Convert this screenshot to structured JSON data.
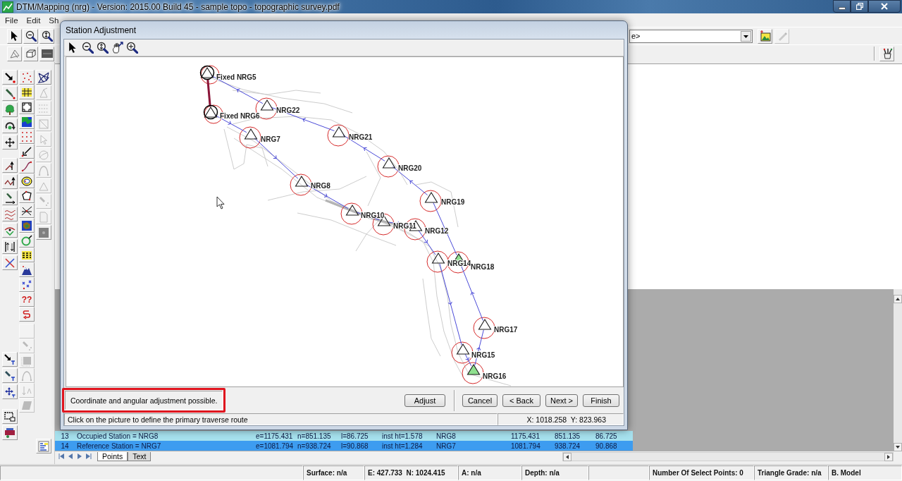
{
  "window": {
    "title": "DTM/Mapping (nrg) - Version: 2015.00 Build 45 - sample topo - topographic survey.pdf"
  },
  "menu": [
    {
      "label": "File"
    },
    {
      "label": "Edit"
    },
    {
      "label": "Sh"
    }
  ],
  "toolbar": {
    "row_1": [
      {
        "kind": "pointer"
      },
      {
        "kind": "zoom-out"
      },
      {
        "kind": "zoom-vertical"
      }
    ],
    "layer_field": {
      "value": "e>"
    },
    "row_1_tools": [
      {
        "kind": "picture",
        "disabled": false
      },
      {
        "kind": "pen",
        "disabled": true
      }
    ],
    "row_2": [
      {
        "kind": "triangle-select"
      },
      {
        "kind": "box-3d"
      },
      {
        "kind": "scale-bar"
      }
    ],
    "row_2_tools": [
      {
        "kind": "brushes"
      }
    ]
  },
  "left_toolbar": [
    {
      "groups": [
        [
          {
            "kind": "pointer-dot",
            "disabled": false
          },
          {
            "kind": "brush",
            "disabled": false
          },
          {
            "kind": "tree",
            "disabled": false
          },
          {
            "kind": "rotate",
            "disabled": false
          },
          {
            "kind": "move",
            "disabled": false
          }
        ],
        [
          {
            "kind": "line-arrow",
            "disabled": false
          },
          {
            "kind": "zigzag",
            "disabled": false
          },
          {
            "kind": "brush-line",
            "disabled": false
          },
          {
            "kind": "waves",
            "disabled": false
          },
          {
            "kind": "curve-dots",
            "disabled": false
          },
          {
            "kind": "split-arrows",
            "disabled": false
          },
          {
            "kind": "cross-arrows",
            "disabled": false
          }
        ],
        [
          {
            "kind": "arrow-t",
            "disabled": false
          },
          {
            "kind": "brush-t",
            "disabled": false
          },
          {
            "kind": "move-t",
            "disabled": false
          }
        ],
        [
          {
            "kind": "frame",
            "disabled": false
          },
          {
            "kind": "plotter",
            "disabled": false
          }
        ]
      ]
    },
    {
      "groups": [
        [
          {
            "kind": "dots",
            "disabled": false
          },
          {
            "kind": "grid",
            "disabled": false
          },
          {
            "kind": "corners",
            "disabled": false
          },
          {
            "kind": "map",
            "disabled": false
          },
          {
            "kind": "dots-row",
            "disabled": false
          },
          {
            "kind": "arrow-sw",
            "disabled": false
          },
          {
            "kind": "curve",
            "disabled": false
          },
          {
            "kind": "contour",
            "disabled": false
          },
          {
            "kind": "polygon",
            "disabled": false
          },
          {
            "kind": "crossing",
            "disabled": false
          },
          {
            "kind": "terrain",
            "disabled": false
          },
          {
            "kind": "ring",
            "disabled": false
          },
          {
            "kind": "table",
            "disabled": false
          },
          {
            "kind": "mountain",
            "disabled": false
          },
          {
            "kind": "scatter-x",
            "disabled": false
          },
          {
            "kind": "text",
            "label": "??",
            "disabled": false
          },
          {
            "kind": "curl",
            "disabled": false
          }
        ],
        [
          {
            "kind": "blank",
            "disabled": true
          },
          {
            "kind": "brush-dots",
            "disabled": true
          },
          {
            "kind": "square-fill",
            "disabled": true
          },
          {
            "kind": "arc",
            "disabled": true
          },
          {
            "kind": "arrow-caret",
            "disabled": true
          },
          {
            "kind": "parallelogram",
            "disabled": true
          }
        ]
      ]
    },
    {
      "groups": [
        [
          {
            "kind": "network",
            "disabled": false
          },
          {
            "kind": "triangle-arrow",
            "disabled": true
          },
          {
            "kind": "dashes",
            "disabled": true
          },
          {
            "kind": "square-diagonal",
            "disabled": true
          },
          {
            "kind": "cursor",
            "disabled": true
          },
          {
            "kind": "circle-curve",
            "disabled": true
          },
          {
            "kind": "arc",
            "disabled": true
          },
          {
            "kind": "tri",
            "disabled": true
          },
          {
            "kind": "brush-dots",
            "disabled": true
          },
          {
            "kind": "page",
            "disabled": true
          },
          {
            "kind": "grey-square",
            "disabled": false
          }
        ],
        [
          {
            "kind": "list",
            "disabled": false
          }
        ]
      ]
    }
  ],
  "dialog": {
    "title": "Station Adjustment",
    "toolbar": [
      {
        "kind": "pointer"
      },
      {
        "kind": "zoom-out"
      },
      {
        "kind": "zoom-vertical"
      },
      {
        "kind": "hand-arrow"
      },
      {
        "kind": "zoom-move"
      }
    ],
    "stations": [
      {
        "label": "Fixed NRG5",
        "kind": "fixed"
      },
      {
        "label": "NRG22",
        "kind": "station"
      },
      {
        "label": "Fixed NRG6",
        "kind": "fixed"
      },
      {
        "label": "NRG7",
        "kind": "station"
      },
      {
        "label": "NRG21",
        "kind": "station"
      },
      {
        "label": "NRG20",
        "kind": "station"
      },
      {
        "label": "NRG8",
        "kind": "station"
      },
      {
        "label": "NRG19",
        "kind": "station"
      },
      {
        "label": "NRG10",
        "kind": "station"
      },
      {
        "label": "NRG11",
        "kind": "station"
      },
      {
        "label": "NRG12",
        "kind": "station"
      },
      {
        "label": "NRG14",
        "kind": "station"
      },
      {
        "label": "NRG18",
        "kind": "marked"
      },
      {
        "label": "NRG17",
        "kind": "station"
      },
      {
        "label": "NRG15",
        "kind": "station"
      },
      {
        "label": "NRG16",
        "kind": "marked"
      }
    ],
    "message": "Coordinate and angular adjustment possible.",
    "message_highlighted": true,
    "adjust_button": {
      "label": "Adjust"
    },
    "wizard_buttons": [
      {
        "label": "Cancel"
      },
      {
        "label": "< Back"
      },
      {
        "label": "Next >"
      },
      {
        "label": "Finish"
      }
    ],
    "hint": "Click on the picture to define the primary traverse route",
    "coordinates": "X: 1018.258  Y: 823.963"
  },
  "table": {
    "rows": [
      {
        "number": "13",
        "cells": [
          "Occupied Station = NRG8",
          "e=1175.431",
          "n=851.135",
          "l=86.725",
          "inst ht=1.578",
          "NRG8",
          "1175.431",
          "851.135",
          "86.725"
        ],
        "selected": false
      },
      {
        "number": "14",
        "cells": [
          "Reference Station = NRG7",
          "e=1081.794",
          "n=938.724",
          "l=90.868",
          "inst ht=1.284",
          "NRG7",
          "1081.794",
          "938.724",
          "90.868"
        ],
        "selected": true
      }
    ]
  },
  "sheet_tabs": [
    {
      "label": "Points",
      "selected": true
    },
    {
      "label": "Text",
      "selected": false
    }
  ],
  "status_bar": [
    "Surface: n/a",
    "E: 427.733  N: 1024.415",
    "A: n/a",
    "Depth: n/a",
    "Number Of Select Points: 0",
    "Triangle Grade: n/a",
    "B. Model"
  ]
}
